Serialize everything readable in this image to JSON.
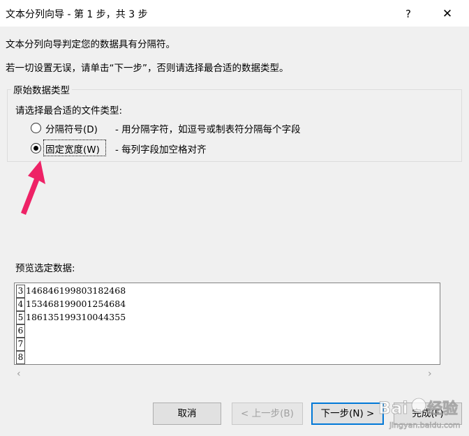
{
  "window": {
    "title": "文本分列向导 - 第 1 步，共 3 步",
    "help_label": "?",
    "close_label": "✕"
  },
  "intro": {
    "line1": "文本分列向导判定您的数据具有分隔符。",
    "line2": "若一切设置无误，请单击“下一步”，否则请选择最合适的数据类型。"
  },
  "group": {
    "legend": "原始数据类型",
    "prompt": "请选择最合适的文件类型:",
    "options": [
      {
        "label": "分隔符号(D)",
        "description": "- 用分隔字符，如逗号或制表符分隔每个字段",
        "selected": false
      },
      {
        "label": "固定宽度(W)",
        "description": "- 每列字段加空格对齐",
        "selected": true
      }
    ]
  },
  "annotation": {
    "arrow_color": "#ee2266"
  },
  "preview": {
    "label": "预览选定数据:",
    "rows": [
      {
        "num": "3",
        "value": "146846199803182468"
      },
      {
        "num": "4",
        "value": "153468199001254684"
      },
      {
        "num": "5",
        "value": "186135199310044355"
      },
      {
        "num": "6",
        "value": ""
      },
      {
        "num": "7",
        "value": ""
      },
      {
        "num": "8",
        "value": ""
      }
    ]
  },
  "buttons": {
    "cancel": "取消",
    "back": "< 上一步(B)",
    "next": "下一步(N) >",
    "finish": "完成(F)"
  },
  "watermark": {
    "text": "Bai 经验",
    "domain": "jingyan.baidu.com"
  },
  "colors": {
    "accent": "#0078d7",
    "background": "#f0f0f0"
  }
}
